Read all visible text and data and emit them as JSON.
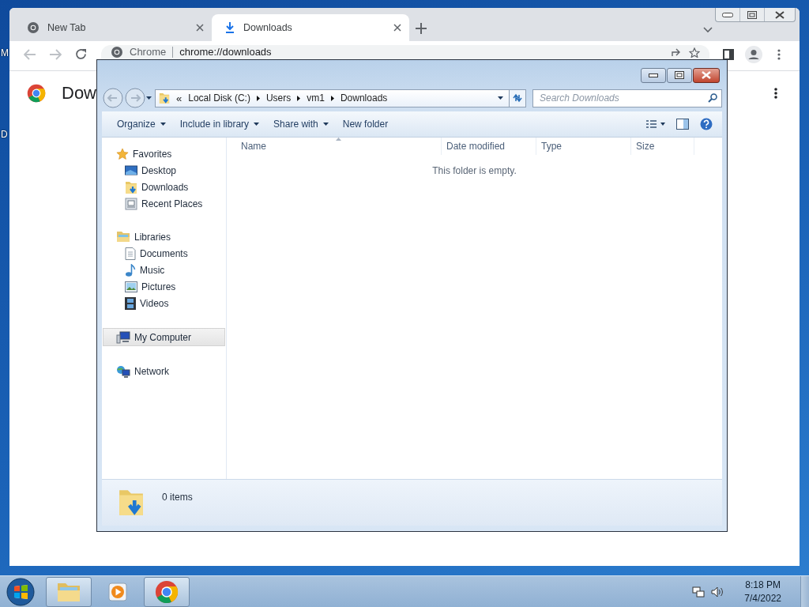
{
  "desktop": {
    "icon_labels": [
      "M",
      "D"
    ]
  },
  "browser": {
    "tabs": [
      {
        "title": "New Tab",
        "selected": false,
        "kind": "chrome"
      },
      {
        "title": "Downloads",
        "selected": true,
        "kind": "download"
      }
    ],
    "address": {
      "site_label": "Chrome",
      "url": "chrome://downloads"
    },
    "page_title": "Dow"
  },
  "explorer": {
    "breadcrumb": {
      "overflow": "«",
      "parts": [
        "Local Disk (C:)",
        "Users",
        "vm1",
        "Downloads"
      ]
    },
    "search": {
      "placeholder": "Search Downloads"
    },
    "toolbar": [
      {
        "label": "Organize",
        "dropdown": true
      },
      {
        "label": "Include in library",
        "dropdown": true
      },
      {
        "label": "Share with",
        "dropdown": true
      },
      {
        "label": "New folder",
        "dropdown": false
      }
    ],
    "nav": [
      {
        "label": "Favorites",
        "kind": "star",
        "selected": false,
        "children": [
          {
            "label": "Desktop",
            "kind": "desktop",
            "selected": false
          },
          {
            "label": "Downloads",
            "kind": "downloads",
            "selected": false
          },
          {
            "label": "Recent Places",
            "kind": "recent",
            "selected": false
          }
        ]
      },
      {
        "label": "Libraries",
        "kind": "library",
        "selected": false,
        "children": [
          {
            "label": "Documents",
            "kind": "document",
            "selected": false
          },
          {
            "label": "Music",
            "kind": "music",
            "selected": false
          },
          {
            "label": "Pictures",
            "kind": "pictures",
            "selected": false
          },
          {
            "label": "Videos",
            "kind": "videos",
            "selected": false
          }
        ]
      },
      {
        "label": "My Computer",
        "kind": "computer",
        "selected": true
      },
      {
        "label": "Network",
        "kind": "network",
        "selected": false
      }
    ],
    "columns": [
      "Name",
      "Date modified",
      "Type",
      "Size"
    ],
    "empty_message": "This folder is empty.",
    "status": "0 items"
  },
  "taskbar": {
    "buttons": [
      {
        "kind": "explorer",
        "running": true
      },
      {
        "kind": "media",
        "running": false
      },
      {
        "kind": "chrome",
        "running": true
      }
    ],
    "time": "8:18 PM",
    "date": "7/4/2022"
  }
}
